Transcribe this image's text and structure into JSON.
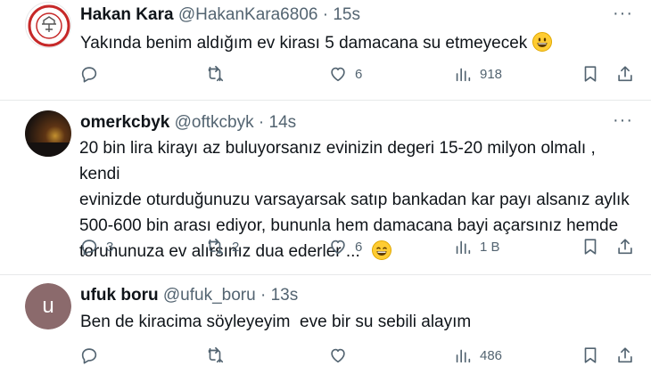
{
  "tweets": [
    {
      "name": "Hakan Kara",
      "handle": "@HakanKara6806",
      "separator": "·",
      "time": "15s",
      "text": "Yakında benim aldığım ev kirası 5 damacana su etmeyecek",
      "emoji": "grinning-face",
      "replies": "",
      "retweets": "",
      "likes": "6",
      "views": "918"
    },
    {
      "name": "omerkcbyk",
      "handle": "@oftkcbyk",
      "separator": "·",
      "time": "14s",
      "text_lines": [
        "20 bin lira kirayı az buluyorsanız evinizin degeri 15-20 milyon olmalı , kendi",
        "evinizde oturduğunuzu varsayarsak satıp bankadan kar payı alsanız aylık",
        "500-600 bin arası ediyor, bununla hem damacana bayi açarsınız hemde",
        "torununuza ev alırsınız dua ederler ..."
      ],
      "emoji": "grinning-smiling-eyes",
      "replies": "3",
      "retweets": "2",
      "likes": "6",
      "views": "1 B"
    },
    {
      "avatar_letter": "u",
      "avatar_color": "#8b6a6c",
      "name": "ufuk boru",
      "handle": "@ufuk_boru",
      "separator": "·",
      "time": "13s",
      "text": "Ben de kiracima söyleyeyim  eve bir su sebili alayım",
      "replies": "",
      "retweets": "",
      "likes": "",
      "views": "486"
    }
  ],
  "more_icon": "more-dots-icon",
  "colors": {
    "text": "#0f1419",
    "muted": "#536471",
    "divider": "#e7e9ea"
  }
}
